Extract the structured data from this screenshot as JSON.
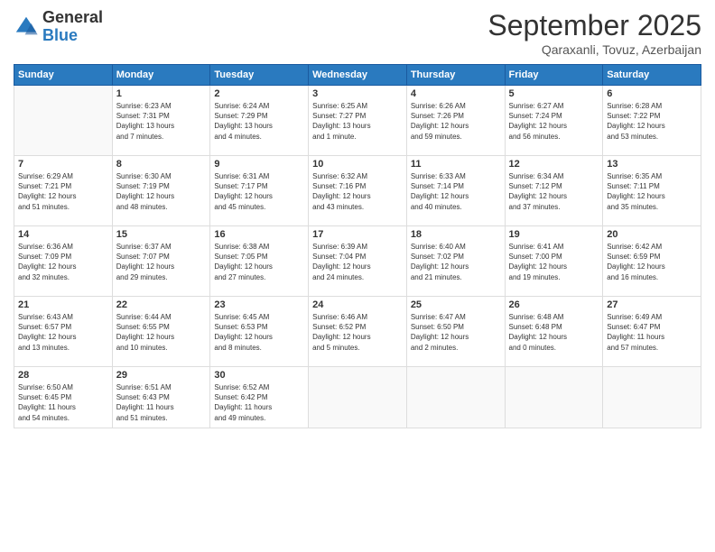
{
  "logo": {
    "general": "General",
    "blue": "Blue"
  },
  "header": {
    "month": "September 2025",
    "location": "Qaraxanli, Tovuz, Azerbaijan"
  },
  "weekdays": [
    "Sunday",
    "Monday",
    "Tuesday",
    "Wednesday",
    "Thursday",
    "Friday",
    "Saturday"
  ],
  "weeks": [
    [
      {
        "day": "",
        "info": ""
      },
      {
        "day": "1",
        "info": "Sunrise: 6:23 AM\nSunset: 7:31 PM\nDaylight: 13 hours\nand 7 minutes."
      },
      {
        "day": "2",
        "info": "Sunrise: 6:24 AM\nSunset: 7:29 PM\nDaylight: 13 hours\nand 4 minutes."
      },
      {
        "day": "3",
        "info": "Sunrise: 6:25 AM\nSunset: 7:27 PM\nDaylight: 13 hours\nand 1 minute."
      },
      {
        "day": "4",
        "info": "Sunrise: 6:26 AM\nSunset: 7:26 PM\nDaylight: 12 hours\nand 59 minutes."
      },
      {
        "day": "5",
        "info": "Sunrise: 6:27 AM\nSunset: 7:24 PM\nDaylight: 12 hours\nand 56 minutes."
      },
      {
        "day": "6",
        "info": "Sunrise: 6:28 AM\nSunset: 7:22 PM\nDaylight: 12 hours\nand 53 minutes."
      }
    ],
    [
      {
        "day": "7",
        "info": "Sunrise: 6:29 AM\nSunset: 7:21 PM\nDaylight: 12 hours\nand 51 minutes."
      },
      {
        "day": "8",
        "info": "Sunrise: 6:30 AM\nSunset: 7:19 PM\nDaylight: 12 hours\nand 48 minutes."
      },
      {
        "day": "9",
        "info": "Sunrise: 6:31 AM\nSunset: 7:17 PM\nDaylight: 12 hours\nand 45 minutes."
      },
      {
        "day": "10",
        "info": "Sunrise: 6:32 AM\nSunset: 7:16 PM\nDaylight: 12 hours\nand 43 minutes."
      },
      {
        "day": "11",
        "info": "Sunrise: 6:33 AM\nSunset: 7:14 PM\nDaylight: 12 hours\nand 40 minutes."
      },
      {
        "day": "12",
        "info": "Sunrise: 6:34 AM\nSunset: 7:12 PM\nDaylight: 12 hours\nand 37 minutes."
      },
      {
        "day": "13",
        "info": "Sunrise: 6:35 AM\nSunset: 7:11 PM\nDaylight: 12 hours\nand 35 minutes."
      }
    ],
    [
      {
        "day": "14",
        "info": "Sunrise: 6:36 AM\nSunset: 7:09 PM\nDaylight: 12 hours\nand 32 minutes."
      },
      {
        "day": "15",
        "info": "Sunrise: 6:37 AM\nSunset: 7:07 PM\nDaylight: 12 hours\nand 29 minutes."
      },
      {
        "day": "16",
        "info": "Sunrise: 6:38 AM\nSunset: 7:05 PM\nDaylight: 12 hours\nand 27 minutes."
      },
      {
        "day": "17",
        "info": "Sunrise: 6:39 AM\nSunset: 7:04 PM\nDaylight: 12 hours\nand 24 minutes."
      },
      {
        "day": "18",
        "info": "Sunrise: 6:40 AM\nSunset: 7:02 PM\nDaylight: 12 hours\nand 21 minutes."
      },
      {
        "day": "19",
        "info": "Sunrise: 6:41 AM\nSunset: 7:00 PM\nDaylight: 12 hours\nand 19 minutes."
      },
      {
        "day": "20",
        "info": "Sunrise: 6:42 AM\nSunset: 6:59 PM\nDaylight: 12 hours\nand 16 minutes."
      }
    ],
    [
      {
        "day": "21",
        "info": "Sunrise: 6:43 AM\nSunset: 6:57 PM\nDaylight: 12 hours\nand 13 minutes."
      },
      {
        "day": "22",
        "info": "Sunrise: 6:44 AM\nSunset: 6:55 PM\nDaylight: 12 hours\nand 10 minutes."
      },
      {
        "day": "23",
        "info": "Sunrise: 6:45 AM\nSunset: 6:53 PM\nDaylight: 12 hours\nand 8 minutes."
      },
      {
        "day": "24",
        "info": "Sunrise: 6:46 AM\nSunset: 6:52 PM\nDaylight: 12 hours\nand 5 minutes."
      },
      {
        "day": "25",
        "info": "Sunrise: 6:47 AM\nSunset: 6:50 PM\nDaylight: 12 hours\nand 2 minutes."
      },
      {
        "day": "26",
        "info": "Sunrise: 6:48 AM\nSunset: 6:48 PM\nDaylight: 12 hours\nand 0 minutes."
      },
      {
        "day": "27",
        "info": "Sunrise: 6:49 AM\nSunset: 6:47 PM\nDaylight: 11 hours\nand 57 minutes."
      }
    ],
    [
      {
        "day": "28",
        "info": "Sunrise: 6:50 AM\nSunset: 6:45 PM\nDaylight: 11 hours\nand 54 minutes."
      },
      {
        "day": "29",
        "info": "Sunrise: 6:51 AM\nSunset: 6:43 PM\nDaylight: 11 hours\nand 51 minutes."
      },
      {
        "day": "30",
        "info": "Sunrise: 6:52 AM\nSunset: 6:42 PM\nDaylight: 11 hours\nand 49 minutes."
      },
      {
        "day": "",
        "info": ""
      },
      {
        "day": "",
        "info": ""
      },
      {
        "day": "",
        "info": ""
      },
      {
        "day": "",
        "info": ""
      }
    ]
  ]
}
